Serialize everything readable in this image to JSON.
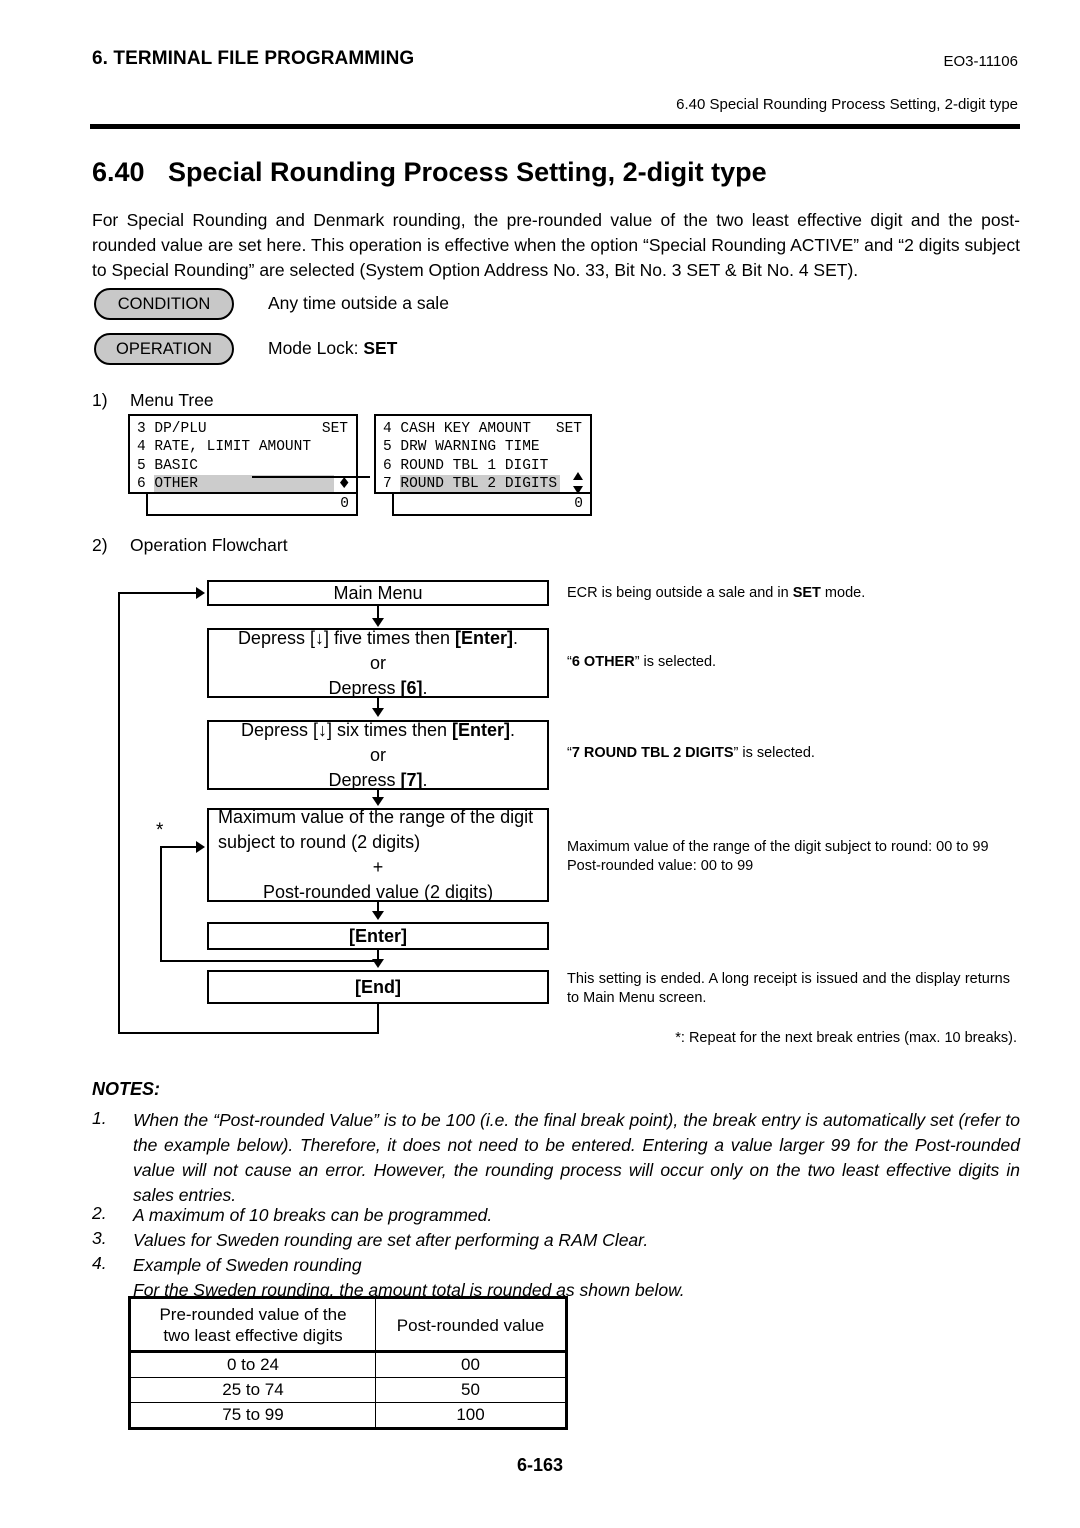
{
  "header": {
    "left_title": "6. TERMINAL FILE PROGRAMMING",
    "doc_code": "EO3-11106",
    "running_head": "6.40 Special Rounding Process Setting, 2-digit type"
  },
  "section": {
    "number": "6.40",
    "title": "Special Rounding Process Setting, 2-digit type",
    "intro": "For Special Rounding and Denmark rounding, the pre-rounded value of the two least effective digit and the post-rounded value are set here.  This operation is effective when the option “Special Rounding ACTIVE” and “2 digits subject to Special Rounding” are selected (System Option Address No. 33, Bit No. 3 SET & Bit No. 4 SET)."
  },
  "badges": {
    "condition_label": "CONDITION",
    "condition_text": "Any time outside a sale",
    "operation_label": "OPERATION",
    "operation_text_prefix": "Mode Lock: ",
    "operation_text_strong": "SET"
  },
  "subheads": {
    "one_num": "1)",
    "one_text": "Menu Tree",
    "two_num": "2)",
    "two_text": "Operation Flowchart"
  },
  "menu_tree": {
    "left_panel": {
      "rows": [
        {
          "index": "3",
          "label": "DP/PLU",
          "right": "SET",
          "highlight": false
        },
        {
          "index": "4",
          "label": "RATE, LIMIT AMOUNT",
          "right": "",
          "highlight": false
        },
        {
          "index": "5",
          "label": "BASIC",
          "right": "",
          "highlight": false
        },
        {
          "index": "6",
          "label": "OTHER",
          "right": "",
          "highlight": true
        }
      ],
      "footer_value": "0",
      "scroll_indicator": "♦"
    },
    "right_panel": {
      "rows": [
        {
          "index": "4",
          "label": "CASH KEY AMOUNT",
          "right": "SET",
          "highlight": false
        },
        {
          "index": "5",
          "label": "DRW WARNING TIME",
          "right": "",
          "highlight": false
        },
        {
          "index": "6",
          "label": "ROUND TBL 1 DIGIT",
          "right": "",
          "highlight": false
        },
        {
          "index": "7",
          "label": "ROUND TBL 2 DIGITS",
          "right": "",
          "highlight": true
        }
      ],
      "footer_value": "0",
      "scroll_indicator": "♦"
    }
  },
  "flowchart": {
    "boxes": [
      {
        "id": "main-menu",
        "lines": [
          "Main Menu"
        ]
      },
      {
        "id": "depress-six",
        "lines": [
          "Depress [↓] five times then [Enter].",
          "or",
          "Depress [6]."
        ]
      },
      {
        "id": "depress-seven",
        "lines": [
          "Depress [↓] six times then [Enter].",
          "or",
          "Depress [7]."
        ]
      },
      {
        "id": "value-entry",
        "lines": [
          "Maximum value of the range of the digit",
          "subject to round (2 digits)",
          "+",
          "Post-rounded value (2 digits)"
        ]
      },
      {
        "id": "enter",
        "lines": [
          "[Enter]"
        ]
      },
      {
        "id": "end",
        "lines": [
          "[End]"
        ]
      }
    ],
    "box_text": {
      "main_menu": "Main Menu",
      "d6_l1_a": "Depress [",
      "d6_l1_arrow": "↓",
      "d6_l1_b": "] five times then ",
      "d6_l1_enter": "[Enter]",
      "d6_l1_c": ".",
      "or": "or",
      "d6_l3_a": "Depress ",
      "d6_l3_key": "[6]",
      "d6_l3_b": ".",
      "d7_l1_a": "Depress [",
      "d7_l1_arrow": "↓",
      "d7_l1_b": "] six times then ",
      "d7_l1_enter": "[Enter]",
      "d7_l1_c": ".",
      "d7_l3_a": "Depress ",
      "d7_l3_key": "[7]",
      "d7_l3_b": ".",
      "val_l1": "Maximum value of the range of the digit",
      "val_l2": "subject to round (2 digits)",
      "val_l3": "+",
      "val_l4": "Post-rounded value (2 digits)",
      "enter": "[Enter]",
      "end": "[End]"
    },
    "annotations": {
      "main_menu_a": "ECR is being outside a sale and in ",
      "main_menu_strong": "SET",
      "main_menu_b": " mode.",
      "other_strong": "6 OTHER",
      "other_tail": "” is selected.",
      "other_lead": "“",
      "round_strong": "7 ROUND TBL 2 DIGITS",
      "round_tail": "” is selected.",
      "round_lead": "“",
      "value_l1": "Maximum value of the range of the digit subject to round: 00 to 99",
      "value_l2": "Post-rounded value: 00 to 99",
      "end_text": "This setting is ended.  A long receipt is issued and the display returns to Main Menu screen.",
      "repeat_note": "*: Repeat for the next break entries (max. 10 breaks).",
      "asterisk": "*"
    }
  },
  "notes": {
    "title": "NOTES:",
    "items": [
      {
        "num": "1.",
        "text": "When the “Post-rounded Value” is to be 100 (i.e. the final break point), the break entry is automatically set (refer to the example below).  Therefore, it does not need to be entered.  Entering a value larger 99 for the Post-rounded value will not cause an error.  However, the rounding process will occur only on the two least effective digits in sales entries."
      },
      {
        "num": "2.",
        "text": "A maximum of 10 breaks can be programmed."
      },
      {
        "num": "3.",
        "text": "Values for Sweden rounding are set after performing a RAM Clear."
      },
      {
        "num": "4.",
        "text": "Example of Sweden rounding"
      }
    ],
    "example_lead": "For the Sweden rounding, the amount total is rounded as shown below."
  },
  "example_table": {
    "headers": [
      "Pre-rounded value of the\ntwo least effective digits",
      "Post-rounded value"
    ],
    "header_col1_line1": "Pre-rounded value of the",
    "header_col1_line2": "two least effective digits",
    "header_col2": "Post-rounded value",
    "rows": [
      {
        "pre": "0 to 24",
        "post": "00"
      },
      {
        "pre": "25 to 74",
        "post": "50"
      },
      {
        "pre": "75 to 99",
        "post": "100"
      }
    ]
  },
  "footer": {
    "page_number": "6-163"
  }
}
